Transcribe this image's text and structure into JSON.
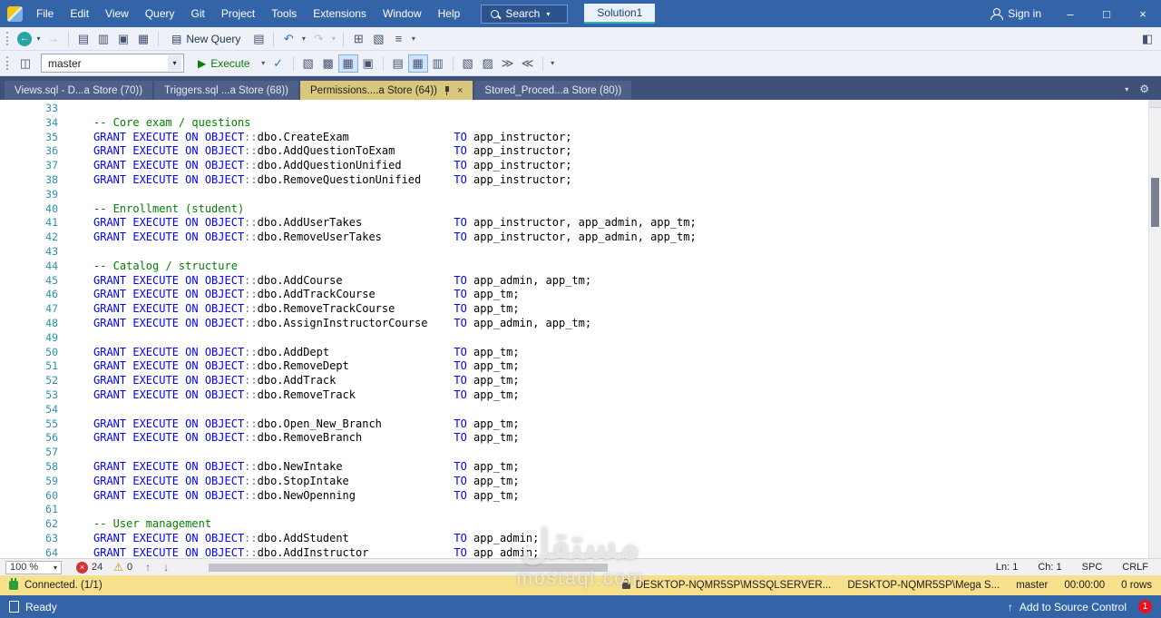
{
  "window": {
    "menu_items": [
      "File",
      "Edit",
      "View",
      "Query",
      "Git",
      "Project",
      "Tools",
      "Extensions",
      "Window",
      "Help"
    ],
    "search_label": "Search",
    "solution_label": "Solution1",
    "sign_in_label": "Sign in"
  },
  "toolbar_main": {
    "items": [
      {
        "name": "nav-backward-icon",
        "glyph": "←",
        "state": "circ"
      },
      {
        "name": "nav-backward-caret-icon",
        "glyph": "▾",
        "state": "caret"
      },
      {
        "name": "nav-forward-icon",
        "glyph": "→",
        "state": "disabled"
      },
      {
        "type": "separator"
      },
      {
        "name": "new-query-file-icon",
        "glyph": "▤"
      },
      {
        "name": "open-file-icon",
        "glyph": "▥"
      },
      {
        "name": "save-icon",
        "glyph": "▣"
      },
      {
        "name": "save-all-icon",
        "glyph": "▦"
      },
      {
        "type": "separator"
      },
      {
        "name": "new-query-button",
        "glyph": "▤",
        "label": "New Query"
      },
      {
        "name": "open-query-icon",
        "glyph": "▤"
      },
      {
        "type": "separator"
      },
      {
        "name": "undo-icon",
        "glyph": "↶",
        "state": "blue"
      },
      {
        "name": "undo-caret-icon",
        "glyph": "▾",
        "state": "caret"
      },
      {
        "name": "redo-icon",
        "glyph": "↷",
        "state": "disabled"
      },
      {
        "name": "redo-caret-icon",
        "glyph": "▾",
        "state": "caret disabled"
      },
      {
        "type": "separator"
      },
      {
        "name": "script-grid-icon",
        "glyph": "⊞"
      },
      {
        "name": "activity-monitor-icon",
        "glyph": "▧"
      },
      {
        "name": "list-members-icon",
        "glyph": "≡"
      },
      {
        "name": "list-members-caret-icon",
        "glyph": "▾",
        "state": "caret"
      }
    ]
  },
  "toolbar_query": {
    "database": "master",
    "items": [
      {
        "name": "execute-button",
        "glyph": "▶",
        "label": "Execute",
        "state": "exec"
      },
      {
        "name": "debug-caret-icon",
        "glyph": "▾",
        "state": "caret"
      },
      {
        "name": "parse-icon",
        "glyph": "✓",
        "state": "blue"
      },
      {
        "type": "separator"
      },
      {
        "name": "estimated-plan-icon",
        "glyph": "▧"
      },
      {
        "name": "query-options-icon",
        "glyph": "▩"
      },
      {
        "name": "intellisense-icon",
        "glyph": "▦",
        "state": "active"
      },
      {
        "name": "sqlcmd-icon",
        "glyph": "▣"
      },
      {
        "type": "separator"
      },
      {
        "name": "results-text-icon",
        "glyph": "▤"
      },
      {
        "name": "results-grid-icon",
        "glyph": "▦",
        "state": "active"
      },
      {
        "name": "results-file-icon",
        "glyph": "▥"
      },
      {
        "type": "separator"
      },
      {
        "name": "comment-icon",
        "glyph": "▧"
      },
      {
        "name": "uncomment-icon",
        "glyph": "▨"
      },
      {
        "name": "indent-icon",
        "glyph": "≫"
      },
      {
        "name": "outdent-icon",
        "glyph": "≪"
      },
      {
        "type": "separator"
      },
      {
        "name": "toolbar-options-caret-icon",
        "glyph": "▾",
        "state": "caret"
      }
    ]
  },
  "tabs": [
    {
      "label": "Views.sql - D...a Store (70))",
      "active": false
    },
    {
      "label": "Triggers.sql ...a Store (68))",
      "active": false
    },
    {
      "label": "Permissions....a Store (64))",
      "active": true
    },
    {
      "label": "Stored_Proced...a Store (80))",
      "active": false
    }
  ],
  "editor": {
    "lines": [
      {
        "n": 33,
        "s": []
      },
      {
        "n": 34,
        "s": [
          [
            "c",
            "-- Core exam / questions"
          ]
        ]
      },
      {
        "n": 35,
        "s": [
          [
            "k",
            "GRANT EXECUTE ON OBJECT"
          ],
          [
            "o",
            "::"
          ],
          [
            "p",
            "dbo.CreateExam                "
          ],
          [
            "k",
            "TO"
          ],
          [
            "p",
            " app_instructor;"
          ]
        ]
      },
      {
        "n": 36,
        "s": [
          [
            "k",
            "GRANT EXECUTE ON OBJECT"
          ],
          [
            "o",
            "::"
          ],
          [
            "p",
            "dbo.AddQuestionToExam         "
          ],
          [
            "k",
            "TO"
          ],
          [
            "p",
            " app_instructor;"
          ]
        ]
      },
      {
        "n": 37,
        "s": [
          [
            "k",
            "GRANT EXECUTE ON OBJECT"
          ],
          [
            "o",
            "::"
          ],
          [
            "p",
            "dbo.AddQuestionUnified        "
          ],
          [
            "k",
            "TO"
          ],
          [
            "p",
            " app_instructor;"
          ]
        ]
      },
      {
        "n": 38,
        "s": [
          [
            "k",
            "GRANT EXECUTE ON OBJECT"
          ],
          [
            "o",
            "::"
          ],
          [
            "p",
            "dbo.RemoveQuestionUnified     "
          ],
          [
            "k",
            "TO"
          ],
          [
            "p",
            " app_instructor;"
          ]
        ]
      },
      {
        "n": 39,
        "s": []
      },
      {
        "n": 40,
        "s": [
          [
            "c",
            "-- Enrollment (student)"
          ]
        ]
      },
      {
        "n": 41,
        "s": [
          [
            "k",
            "GRANT EXECUTE ON OBJECT"
          ],
          [
            "o",
            "::"
          ],
          [
            "p",
            "dbo.AddUserTakes              "
          ],
          [
            "k",
            "TO"
          ],
          [
            "p",
            " app_instructor, app_admin, app_tm;"
          ]
        ]
      },
      {
        "n": 42,
        "s": [
          [
            "k",
            "GRANT EXECUTE ON OBJECT"
          ],
          [
            "o",
            "::"
          ],
          [
            "p",
            "dbo.RemoveUserTakes           "
          ],
          [
            "k",
            "TO"
          ],
          [
            "p",
            " app_instructor, app_admin, app_tm;"
          ]
        ]
      },
      {
        "n": 43,
        "s": []
      },
      {
        "n": 44,
        "s": [
          [
            "c",
            "-- Catalog / structure"
          ]
        ]
      },
      {
        "n": 45,
        "s": [
          [
            "k",
            "GRANT EXECUTE ON OBJECT"
          ],
          [
            "o",
            "::"
          ],
          [
            "p",
            "dbo.AddCourse                 "
          ],
          [
            "k",
            "TO"
          ],
          [
            "p",
            " app_admin, app_tm;"
          ]
        ]
      },
      {
        "n": 46,
        "s": [
          [
            "k",
            "GRANT EXECUTE ON OBJECT"
          ],
          [
            "o",
            "::"
          ],
          [
            "p",
            "dbo.AddTrackCourse            "
          ],
          [
            "k",
            "TO"
          ],
          [
            "p",
            " app_tm;"
          ]
        ]
      },
      {
        "n": 47,
        "s": [
          [
            "k",
            "GRANT EXECUTE ON OBJECT"
          ],
          [
            "o",
            "::"
          ],
          [
            "p",
            "dbo.RemoveTrackCourse         "
          ],
          [
            "k",
            "TO"
          ],
          [
            "p",
            " app_tm;"
          ]
        ]
      },
      {
        "n": 48,
        "s": [
          [
            "k",
            "GRANT EXECUTE ON OBJECT"
          ],
          [
            "o",
            "::"
          ],
          [
            "p",
            "dbo.AssignInstructorCourse    "
          ],
          [
            "k",
            "TO"
          ],
          [
            "p",
            " app_admin, app_tm;"
          ]
        ]
      },
      {
        "n": 49,
        "s": []
      },
      {
        "n": 50,
        "s": [
          [
            "k",
            "GRANT EXECUTE ON OBJECT"
          ],
          [
            "o",
            "::"
          ],
          [
            "p",
            "dbo.AddDept                   "
          ],
          [
            "k",
            "TO"
          ],
          [
            "p",
            " app_tm;"
          ]
        ]
      },
      {
        "n": 51,
        "s": [
          [
            "k",
            "GRANT EXECUTE ON OBJECT"
          ],
          [
            "o",
            "::"
          ],
          [
            "p",
            "dbo.RemoveDept                "
          ],
          [
            "k",
            "TO"
          ],
          [
            "p",
            " app_tm;"
          ]
        ]
      },
      {
        "n": 52,
        "s": [
          [
            "k",
            "GRANT EXECUTE ON OBJECT"
          ],
          [
            "o",
            "::"
          ],
          [
            "p",
            "dbo.AddTrack                  "
          ],
          [
            "k",
            "TO"
          ],
          [
            "p",
            " app_tm;"
          ]
        ]
      },
      {
        "n": 53,
        "s": [
          [
            "k",
            "GRANT EXECUTE ON OBJECT"
          ],
          [
            "o",
            "::"
          ],
          [
            "p",
            "dbo.RemoveTrack               "
          ],
          [
            "k",
            "TO"
          ],
          [
            "p",
            " app_tm;"
          ]
        ]
      },
      {
        "n": 54,
        "s": []
      },
      {
        "n": 55,
        "s": [
          [
            "k",
            "GRANT EXECUTE ON OBJECT"
          ],
          [
            "o",
            "::"
          ],
          [
            "p",
            "dbo.Open_New_Branch           "
          ],
          [
            "k",
            "TO"
          ],
          [
            "p",
            " app_tm;"
          ]
        ]
      },
      {
        "n": 56,
        "s": [
          [
            "k",
            "GRANT EXECUTE ON OBJECT"
          ],
          [
            "o",
            "::"
          ],
          [
            "p",
            "dbo.RemoveBranch              "
          ],
          [
            "k",
            "TO"
          ],
          [
            "p",
            " app_tm;"
          ]
        ]
      },
      {
        "n": 57,
        "s": []
      },
      {
        "n": 58,
        "s": [
          [
            "k",
            "GRANT EXECUTE ON OBJECT"
          ],
          [
            "o",
            "::"
          ],
          [
            "p",
            "dbo.NewIntake                 "
          ],
          [
            "k",
            "TO"
          ],
          [
            "p",
            " app_tm;"
          ]
        ]
      },
      {
        "n": 59,
        "s": [
          [
            "k",
            "GRANT EXECUTE ON OBJECT"
          ],
          [
            "o",
            "::"
          ],
          [
            "p",
            "dbo.StopIntake                "
          ],
          [
            "k",
            "TO"
          ],
          [
            "p",
            " app_tm;"
          ]
        ]
      },
      {
        "n": 60,
        "s": [
          [
            "k",
            "GRANT EXECUTE ON OBJECT"
          ],
          [
            "o",
            "::"
          ],
          [
            "p",
            "dbo.NewOpenning               "
          ],
          [
            "k",
            "TO"
          ],
          [
            "p",
            " app_tm;"
          ]
        ]
      },
      {
        "n": 61,
        "s": []
      },
      {
        "n": 62,
        "s": [
          [
            "c",
            "-- User management"
          ]
        ]
      },
      {
        "n": 63,
        "s": [
          [
            "k",
            "GRANT EXECUTE ON OBJECT"
          ],
          [
            "o",
            "::"
          ],
          [
            "p",
            "dbo.AddStudent                "
          ],
          [
            "k",
            "TO"
          ],
          [
            "p",
            " app_admin;"
          ]
        ]
      },
      {
        "n": 64,
        "s": [
          [
            "k",
            "GRANT EXECUTE ON OBJECT"
          ],
          [
            "o",
            "::"
          ],
          [
            "p",
            "dbo.AddInstructor             "
          ],
          [
            "k",
            "TO"
          ],
          [
            "p",
            " app_admin;"
          ]
        ]
      }
    ]
  },
  "status_row": {
    "zoom": "100 %",
    "error_count": "24",
    "warning_count": "0",
    "ln": "Ln: 1",
    "ch": "Ch: 1",
    "spc": "SPC",
    "eol": "CRLF"
  },
  "connection_bar": {
    "connected": "Connected. (1/1)",
    "server": "DESKTOP-NQMR5SP\\MSSQLSERVER...",
    "database_path": "DESKTOP-NQMR5SP\\Mega S...",
    "database": "master",
    "duration": "00:00:00",
    "rows": "0 rows"
  },
  "status_bar": {
    "ready": "Ready",
    "source_control": "Add to Source Control",
    "notification_count": "1"
  },
  "watermark": {
    "arabic": "مستقل",
    "domain": "mostaql.com"
  },
  "colors": {
    "accent_blue": "#3464a8",
    "tab_active": "#d9c77c",
    "keyword": "#0000ff",
    "comment": "#008000",
    "connected_bar": "#f7e08b",
    "line_number": "#2b91af"
  }
}
